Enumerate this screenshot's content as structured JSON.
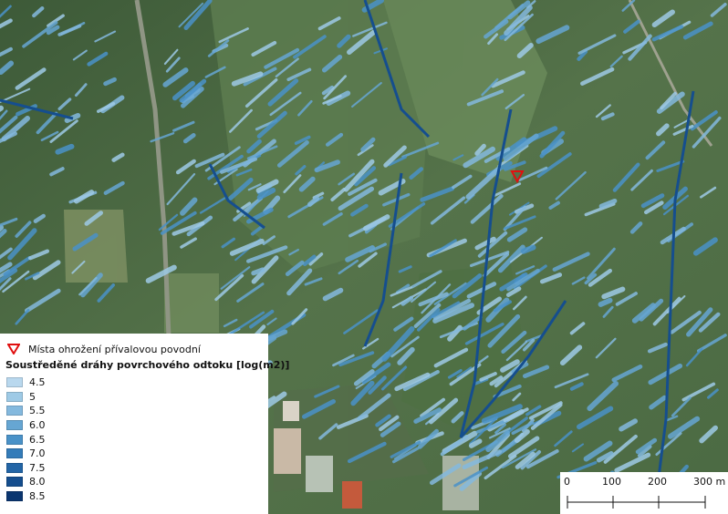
{
  "legend": {
    "flood_point_label": "Místa ohrožení přívalovou povodní",
    "flood_point_color": "#e01010",
    "runoff_title": "Soustředěné dráhy povrchového odtoku [log(m2)]",
    "classes": [
      {
        "label": "4.5",
        "color": "#b9d8ee"
      },
      {
        "label": "5",
        "color": "#9ecae6"
      },
      {
        "label": "5.5",
        "color": "#84b9de"
      },
      {
        "label": "6.0",
        "color": "#66a6d3"
      },
      {
        "label": "6.5",
        "color": "#4a92c8"
      },
      {
        "label": "7.0",
        "color": "#347cb9"
      },
      {
        "label": "7.5",
        "color": "#2365a6"
      },
      {
        "label": "8.0",
        "color": "#154e8e"
      },
      {
        "label": "8.5",
        "color": "#0b3670"
      }
    ]
  },
  "scalebar": {
    "ticks": [
      "0",
      "100",
      "200",
      "300 m"
    ]
  },
  "colors": {
    "vegetation_dark": "#3f5c3a",
    "vegetation_light": "#5f7e52",
    "runoff_main": "#3a8ed6"
  }
}
